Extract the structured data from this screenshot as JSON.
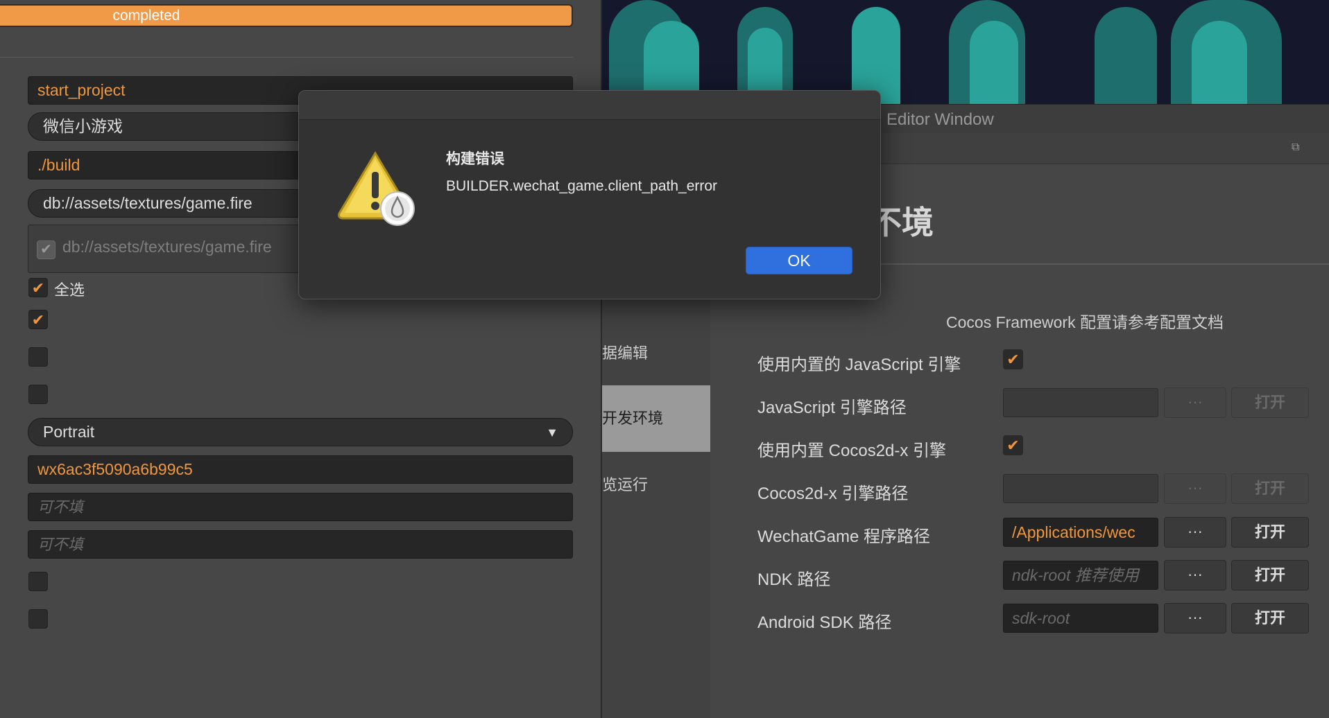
{
  "build_panel": {
    "progress_label": "completed",
    "game_name": "start_project",
    "platform": "微信小游戏",
    "build_path": "./build",
    "start_scene": "db://assets/textures/game.fire",
    "scene_list_item": "db://assets/textures/game.fire",
    "select_all_label": "全选",
    "orientation": "Portrait",
    "appid": "wx6ac3f5090a6b99c5",
    "optional_placeholder_1": "可不填",
    "optional_placeholder_2": "可不填"
  },
  "editor": {
    "window_title": "Editor Window",
    "heading": "不境",
    "sidebar": {
      "items": [
        {
          "label": "数据编辑"
        },
        {
          "label": "主开发环境"
        },
        {
          "label": "预览运行"
        }
      ]
    },
    "note": "Cocos Framework 配置请参考配置文档",
    "rows": {
      "builtin_js_label": "使用内置的 JavaScript 引擎",
      "js_path_label": "JavaScript 引擎路径",
      "builtin_cocos_label": "使用内置 Cocos2d-x 引擎",
      "cocos_path_label": "Cocos2d-x 引擎路径",
      "wechat_label": "WechatGame 程序路径",
      "wechat_value": "/Applications/wec",
      "ndk_label": "NDK 路径",
      "ndk_placeholder": "ndk-root 推荐使用",
      "android_label": "Android SDK 路径",
      "android_placeholder": "sdk-root"
    },
    "dots_label": "···",
    "open_label": "打开"
  },
  "dialog": {
    "title": "构建错误",
    "message": "BUILDER.wechat_game.client_path_error",
    "ok_label": "OK",
    "icon": "warning-icon"
  },
  "colors": {
    "accent": "#f09a48",
    "ok_button": "#2f6fde"
  }
}
